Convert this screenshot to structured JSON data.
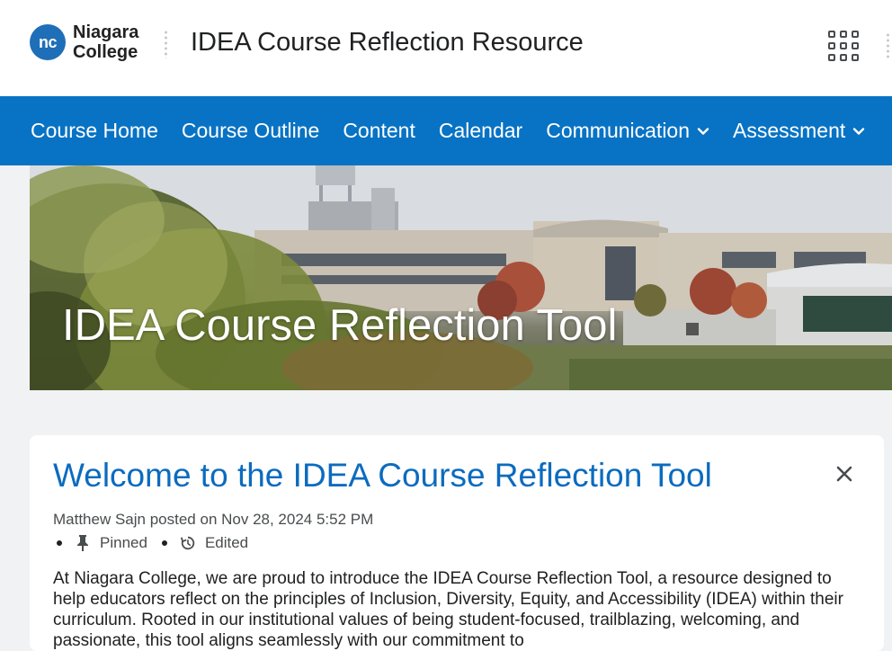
{
  "header": {
    "logo": {
      "badge": "nc",
      "line1": "Niagara",
      "line2": "College"
    },
    "site_title": "IDEA Course Reflection Resource"
  },
  "nav": {
    "items": [
      {
        "label": "Course Home"
      },
      {
        "label": "Course Outline"
      },
      {
        "label": "Content"
      },
      {
        "label": "Calendar"
      },
      {
        "label": "Communication"
      },
      {
        "label": "Assessment"
      }
    ]
  },
  "banner": {
    "title": "IDEA Course Reflection Tool"
  },
  "announcement": {
    "title": "Welcome to the IDEA Course Reflection Tool",
    "byline": "Matthew Sajn posted on Nov 28, 2024 5:52 PM",
    "pinned_label": "Pinned",
    "edited_label": "Edited",
    "body": "At Niagara College, we are proud to introduce the IDEA Course Reflection Tool, a resource designed to help educators reflect on the principles of Inclusion, Diversity, Equity, and Accessibility (IDEA) within their curriculum. Rooted in our institutional values of being student-focused, trailblazing, welcoming, and passionate, this tool aligns seamlessly with our commitment to"
  },
  "colors": {
    "brand_blue": "#0873c4",
    "link_blue": "#0b6bbf"
  },
  "icons": [
    "apps-grid-icon",
    "chevron-down-icon",
    "close-icon",
    "pin-icon",
    "edited-icon"
  ]
}
